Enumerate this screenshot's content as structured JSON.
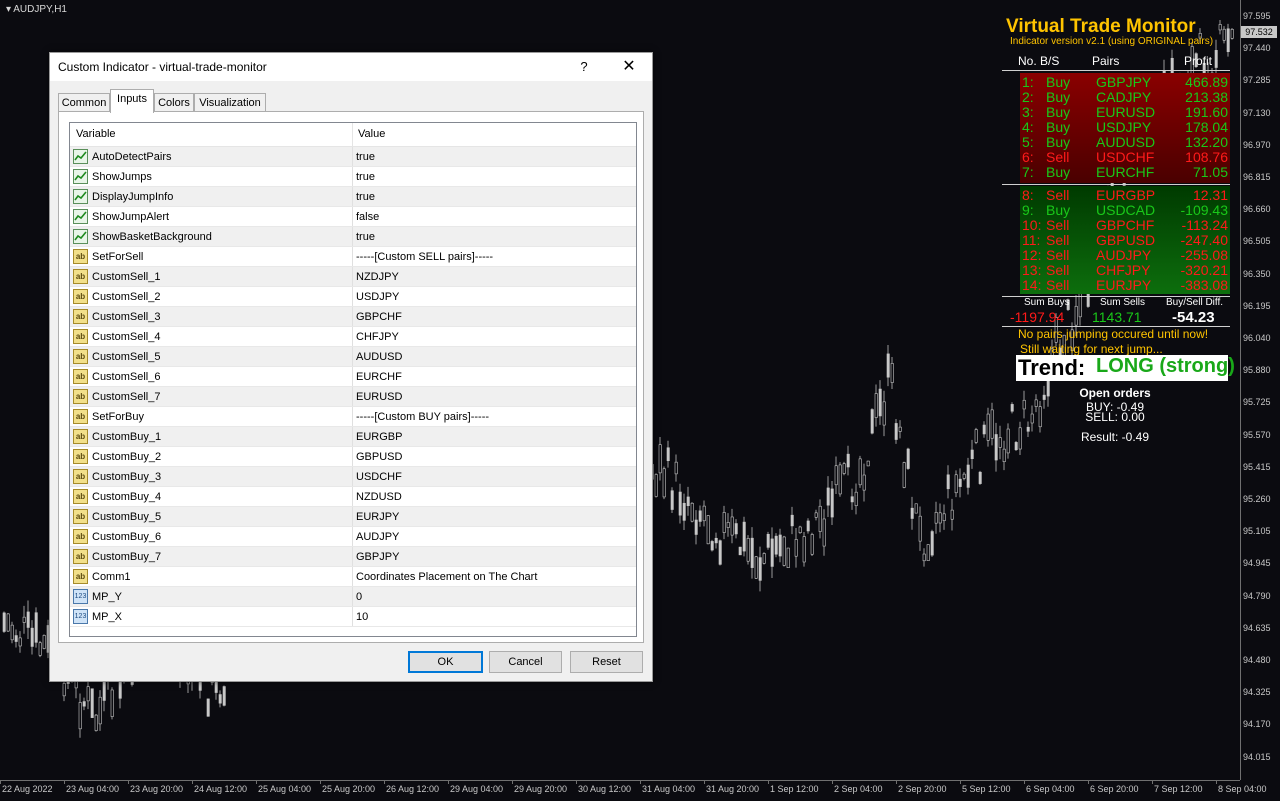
{
  "chart": {
    "symbol": "AUDJPY,H1",
    "current_price": "97.532",
    "price_labels": [
      "97.595",
      "97.440",
      "97.285",
      "97.130",
      "96.970",
      "96.815",
      "96.660",
      "96.505",
      "96.350",
      "96.195",
      "96.040",
      "95.880",
      "95.725",
      "95.570",
      "95.415",
      "95.260",
      "95.105",
      "94.945",
      "94.790",
      "94.635",
      "94.480",
      "94.325",
      "94.170",
      "94.015"
    ],
    "time_labels": [
      "22 Aug 2022",
      "23 Aug 04:00",
      "23 Aug 20:00",
      "24 Aug 12:00",
      "25 Aug 04:00",
      "25 Aug 20:00",
      "26 Aug 12:00",
      "29 Aug 04:00",
      "29 Aug 20:00",
      "30 Aug 12:00",
      "31 Aug 04:00",
      "31 Aug 20:00",
      "1 Sep 12:00",
      "2 Sep 04:00",
      "2 Sep 20:00",
      "5 Sep 12:00",
      "6 Sep 04:00",
      "6 Sep 20:00",
      "7 Sep 12:00",
      "8 Sep 04:00"
    ],
    "colors": {
      "background": "#0b0b10",
      "candle": "#c8c8c8"
    }
  },
  "vtm": {
    "title": "Virtual Trade Monitor",
    "subtitle": "Indicator version v2.1 (using ORIGINAL pairs)",
    "headers": {
      "no_bs": "No. B/S",
      "pairs": "Pairs",
      "profit": "Profit"
    },
    "buy_rows": [
      {
        "num": "1:",
        "side": "Buy",
        "pair": "GBPJPY",
        "profit": "466.89"
      },
      {
        "num": "2:",
        "side": "Buy",
        "pair": "CADJPY",
        "profit": "213.38"
      },
      {
        "num": "3:",
        "side": "Buy",
        "pair": "EURUSD",
        "profit": "191.60"
      },
      {
        "num": "4:",
        "side": "Buy",
        "pair": "USDJPY",
        "profit": "178.04"
      },
      {
        "num": "5:",
        "side": "Buy",
        "pair": "AUDUSD",
        "profit": "132.20"
      },
      {
        "num": "6:",
        "side": "Sell",
        "pair": "USDCHF",
        "profit": "108.76"
      },
      {
        "num": "7:",
        "side": "Buy",
        "pair": "EURCHF",
        "profit": "71.05"
      }
    ],
    "sell_rows": [
      {
        "num": "8:",
        "side": "Sell",
        "pair": "EURGBP",
        "profit": "12.31"
      },
      {
        "num": "9:",
        "side": "Buy",
        "pair": "USDCAD",
        "profit": "-109.43"
      },
      {
        "num": "10:",
        "side": "Sell",
        "pair": "GBPCHF",
        "profit": "-113.24"
      },
      {
        "num": "11:",
        "side": "Sell",
        "pair": "GBPUSD",
        "profit": "-247.40"
      },
      {
        "num": "12:",
        "side": "Sell",
        "pair": "AUDJPY",
        "profit": "-255.08"
      },
      {
        "num": "13:",
        "side": "Sell",
        "pair": "CHFJPY",
        "profit": "-320.21"
      },
      {
        "num": "14:",
        "side": "Sell",
        "pair": "EURJPY",
        "profit": "-383.08"
      }
    ],
    "sum_buys_label": "Sum Buys",
    "sum_sells_label": "Sum Sells",
    "diff_label": "Buy/Sell Diff.",
    "sum_buys": "-1197.94",
    "sum_sells": "1143.71",
    "diff": "-54.23",
    "msg1": "No pairs jumping occured until now!",
    "msg2": "Still waiting for next jump...",
    "trend_label": "Trend:",
    "trend_value": "LONG (strong)",
    "open_orders_label": "Open orders",
    "buy_line": "BUY: -0.49",
    "sell_line": "SELL: 0.00",
    "result_line": "Result: -0.49",
    "colors": {
      "title": "#ffc400",
      "buy": "#19c819",
      "sell": "#ff1a1a",
      "top_bg": "#7a0000",
      "bottom_bg": "#0a5a0a"
    }
  },
  "dialog": {
    "title": "Custom Indicator - virtual-trade-monitor",
    "help": "?",
    "close": "✕",
    "tabs": [
      "Common",
      "Inputs",
      "Colors",
      "Visualization"
    ],
    "col_variable": "Variable",
    "col_value": "Value",
    "rows": [
      {
        "type": "bool",
        "name": "AutoDetectPairs",
        "value": "true"
      },
      {
        "type": "bool",
        "name": "ShowJumps",
        "value": "true"
      },
      {
        "type": "bool",
        "name": "DisplayJumpInfo",
        "value": "true"
      },
      {
        "type": "bool",
        "name": "ShowJumpAlert",
        "value": "false"
      },
      {
        "type": "bool",
        "name": "ShowBasketBackground",
        "value": "true"
      },
      {
        "type": "str",
        "name": "SetForSell",
        "value": "-----[Custom SELL pairs]-----"
      },
      {
        "type": "str",
        "name": "CustomSell_1",
        "value": "NZDJPY"
      },
      {
        "type": "str",
        "name": "CustomSell_2",
        "value": "USDJPY"
      },
      {
        "type": "str",
        "name": "CustomSell_3",
        "value": "GBPCHF"
      },
      {
        "type": "str",
        "name": "CustomSell_4",
        "value": "CHFJPY"
      },
      {
        "type": "str",
        "name": "CustomSell_5",
        "value": "AUDUSD"
      },
      {
        "type": "str",
        "name": "CustomSell_6",
        "value": "EURCHF"
      },
      {
        "type": "str",
        "name": "CustomSell_7",
        "value": "EURUSD"
      },
      {
        "type": "str",
        "name": "SetForBuy",
        "value": "-----[Custom BUY pairs]-----"
      },
      {
        "type": "str",
        "name": "CustomBuy_1",
        "value": "EURGBP"
      },
      {
        "type": "str",
        "name": "CustomBuy_2",
        "value": "GBPUSD"
      },
      {
        "type": "str",
        "name": "CustomBuy_3",
        "value": "USDCHF"
      },
      {
        "type": "str",
        "name": "CustomBuy_4",
        "value": "NZDUSD"
      },
      {
        "type": "str",
        "name": "CustomBuy_5",
        "value": "EURJPY"
      },
      {
        "type": "str",
        "name": "CustomBuy_6",
        "value": "AUDJPY"
      },
      {
        "type": "str",
        "name": "CustomBuy_7",
        "value": "GBPJPY"
      },
      {
        "type": "str",
        "name": "Comm1",
        "value": "Coordinates Placement on The Chart"
      },
      {
        "type": "int",
        "name": "MP_Y",
        "value": "0"
      },
      {
        "type": "int",
        "name": "MP_X",
        "value": "10"
      }
    ],
    "ok": "OK",
    "cancel": "Cancel",
    "reset": "Reset"
  }
}
